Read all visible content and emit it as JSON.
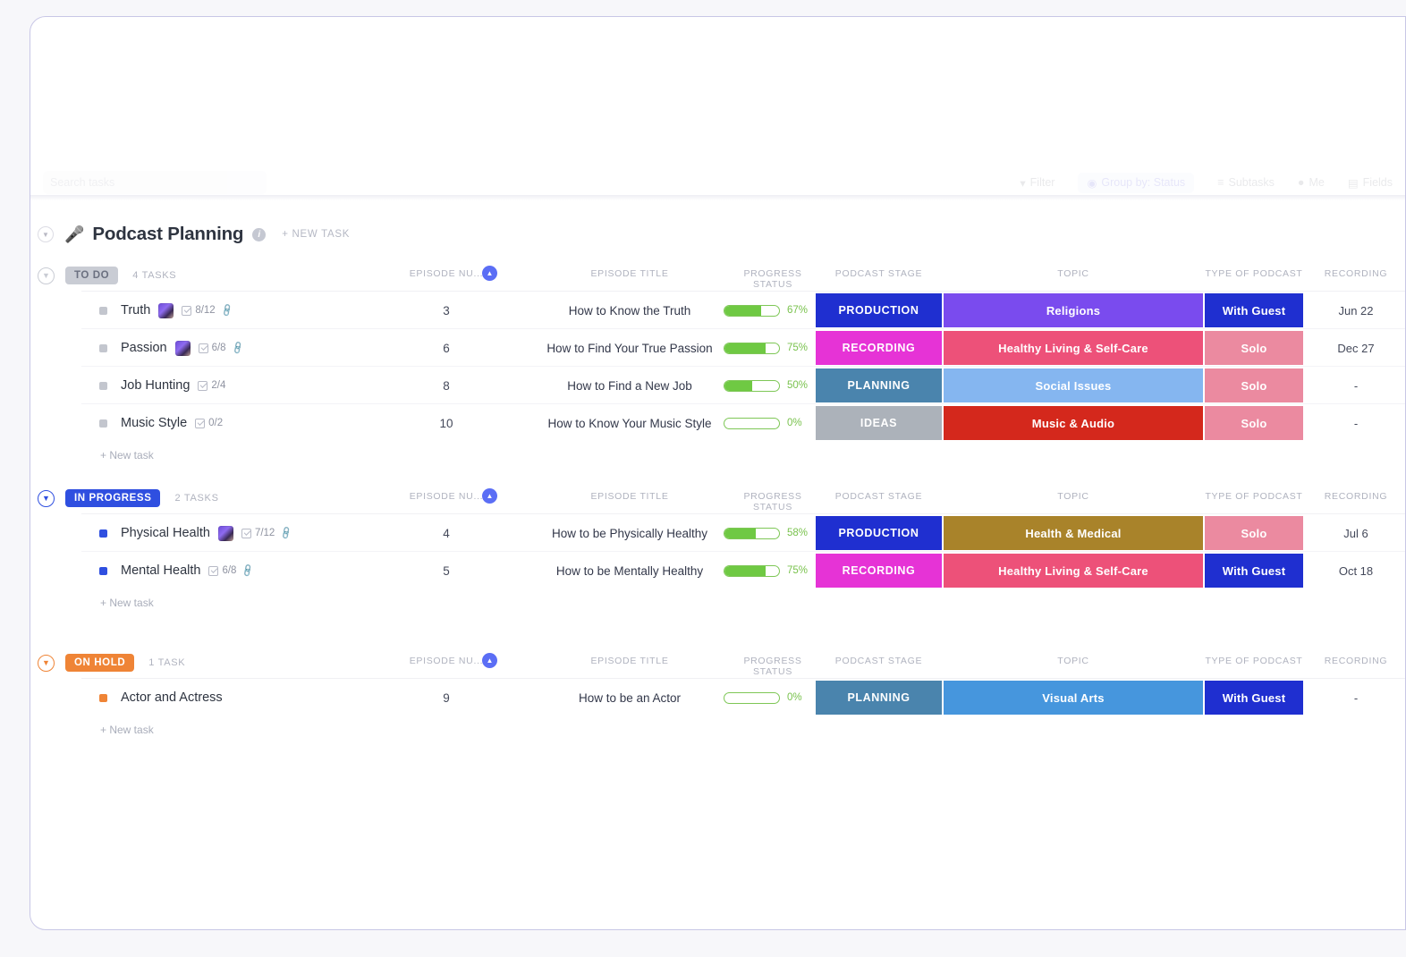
{
  "toolbar": {
    "search_placeholder": "Search tasks",
    "items": [
      {
        "label": "Filter",
        "icon": "filter-icon",
        "active": false
      },
      {
        "label": "Group by: Status",
        "icon": "group-icon",
        "active": true
      },
      {
        "label": "Subtasks",
        "icon": "subtask-icon",
        "active": false
      },
      {
        "label": "Me",
        "icon": "person-icon",
        "active": false
      },
      {
        "label": "Fields",
        "icon": "fields-icon",
        "active": false
      }
    ]
  },
  "list": {
    "title": "Podcast Planning",
    "icon": "microphone-icon",
    "info_icon": "info-icon",
    "new_task_label": "+ NEW TASK",
    "collapse_icon": "chevron-down-icon"
  },
  "columns": {
    "episode_number": "EPISODE NU...",
    "episode_title": "EPISODE TITLE",
    "progress_status": "PROGRESS STATUS",
    "podcast_stage": "PODCAST STAGE",
    "topic": "TOPIC",
    "type_of_podcast": "TYPE OF PODCAST",
    "recording_date": "RECORDING"
  },
  "new_task_label": "+ New task",
  "groups": [
    {
      "status": "TO DO",
      "status_color": "#c9ccd4",
      "status_text_color": "#6b7080",
      "caret_color": "#c9ccd4",
      "count_label": "4 TASKS",
      "tasks": [
        {
          "name": "Truth",
          "dot_color": "#c3c6ce",
          "avatar": true,
          "subtasks": "8/12",
          "attachment": true,
          "episode_number": "3",
          "episode_title": "How to Know the Truth",
          "progress": "67%",
          "progress_value": 67,
          "stage": "PRODUCTION",
          "stage_color": "#1f2fd0",
          "topic": "Religions",
          "topic_color": "#7a4bee",
          "type": "With Guest",
          "type_color": "#1f2fd0",
          "date": "Jun 22"
        },
        {
          "name": "Passion",
          "dot_color": "#c3c6ce",
          "avatar": true,
          "subtasks": "6/8",
          "attachment": true,
          "episode_number": "6",
          "episode_title": "How to Find Your True Passion",
          "progress": "75%",
          "progress_value": 75,
          "stage": "RECORDING",
          "stage_color": "#e633d6",
          "topic": "Healthy Living & Self-Care",
          "topic_color": "#ed5179",
          "type": "Solo",
          "type_color": "#eb8aa0",
          "date": "Dec 27"
        },
        {
          "name": "Job Hunting",
          "dot_color": "#c3c6ce",
          "avatar": false,
          "subtasks": "2/4",
          "attachment": false,
          "episode_number": "8",
          "episode_title": "How to Find a New Job",
          "progress": "50%",
          "progress_value": 50,
          "stage": "PLANNING",
          "stage_color": "#4a84ad",
          "topic": "Social Issues",
          "topic_color": "#85b6f0",
          "type": "Solo",
          "type_color": "#eb8aa0",
          "date": "-"
        },
        {
          "name": "Music Style",
          "dot_color": "#c3c6ce",
          "avatar": false,
          "subtasks": "0/2",
          "attachment": false,
          "episode_number": "10",
          "episode_title": "How to Know Your Music Style",
          "progress": "0%",
          "progress_value": 0,
          "stage": "IDEAS",
          "stage_color": "#acb2ba",
          "topic": "Music & Audio",
          "topic_color": "#d4281c",
          "type": "Solo",
          "type_color": "#eb8aa0",
          "date": "-"
        }
      ]
    },
    {
      "status": "IN PROGRESS",
      "status_color": "#2f4fe0",
      "status_text_color": "#ffffff",
      "caret_color": "#2f4fe0",
      "count_label": "2 TASKS",
      "tasks": [
        {
          "name": "Physical Health",
          "dot_color": "#2f4fe0",
          "avatar": true,
          "subtasks": "7/12",
          "attachment": true,
          "episode_number": "4",
          "episode_title": "How to be Physically Healthy",
          "progress": "58%",
          "progress_value": 58,
          "stage": "PRODUCTION",
          "stage_color": "#1f2fd0",
          "topic": "Health & Medical",
          "topic_color": "#a9832a",
          "type": "Solo",
          "type_color": "#eb8aa0",
          "date": "Jul 6"
        },
        {
          "name": "Mental Health",
          "dot_color": "#2f4fe0",
          "avatar": false,
          "subtasks": "6/8",
          "attachment": true,
          "episode_number": "5",
          "episode_title": "How to be Mentally Healthy",
          "progress": "75%",
          "progress_value": 75,
          "stage": "RECORDING",
          "stage_color": "#e633d6",
          "topic": "Healthy Living & Self-Care",
          "topic_color": "#ed5179",
          "type": "With Guest",
          "type_color": "#1f2fd0",
          "date": "Oct 18"
        }
      ]
    },
    {
      "status": "ON HOLD",
      "status_color": "#ef8436",
      "status_text_color": "#ffffff",
      "caret_color": "#ef8436",
      "count_label": "1 TASK",
      "tasks": [
        {
          "name": "Actor and Actress",
          "dot_color": "#ef8436",
          "avatar": false,
          "subtasks": "",
          "attachment": false,
          "episode_number": "9",
          "episode_title": "How to be an Actor",
          "progress": "0%",
          "progress_value": 0,
          "stage": "PLANNING",
          "stage_color": "#4a84ad",
          "topic": "Visual Arts",
          "topic_color": "#4696dd",
          "type": "With Guest",
          "type_color": "#1f2fd0",
          "date": "-"
        }
      ]
    }
  ]
}
